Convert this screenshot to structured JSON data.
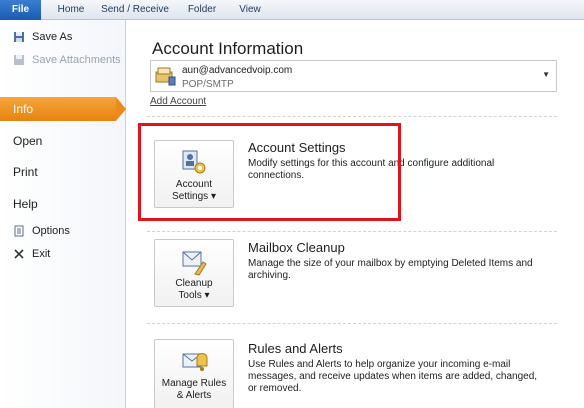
{
  "tabs": [
    {
      "label": "File"
    },
    {
      "label": "Home"
    },
    {
      "label": "Send / Receive"
    },
    {
      "label": "Folder"
    },
    {
      "label": "View"
    }
  ],
  "nav": {
    "save_as": "Save As",
    "save_attachments": "Save Attachments",
    "info": "Info",
    "open": "Open",
    "print": "Print",
    "help": "Help",
    "options": "Options",
    "exit": "Exit"
  },
  "main": {
    "heading": "Account Information",
    "account": {
      "email": "aun@advancedvoip.com",
      "type": "POP/SMTP"
    },
    "add_account": "Add Account",
    "sections": [
      {
        "button_line1": "Account",
        "button_line2": "Settings ▾",
        "title": "Account Settings",
        "description": "Modify settings for this account and configure additional connections."
      },
      {
        "button_line1": "Cleanup",
        "button_line2": "Tools ▾",
        "title": "Mailbox Cleanup",
        "description": "Manage the size of your mailbox by emptying Deleted Items and archiving."
      },
      {
        "button_line1": "Manage Rules",
        "button_line2": "& Alerts",
        "title": "Rules and Alerts",
        "description": "Use Rules and Alerts to help organize your incoming e-mail messages, and receive updates when items are added, changed, or removed."
      }
    ]
  },
  "colors": {
    "file_tab": "#1a5bb1",
    "info_highlight": "#ec8b1c",
    "annotation_box": "#e2141b"
  },
  "icons": {
    "save_as": "save-as-icon",
    "save_attachments": "save-attachments-icon",
    "options": "options-icon",
    "exit": "exit-icon"
  }
}
